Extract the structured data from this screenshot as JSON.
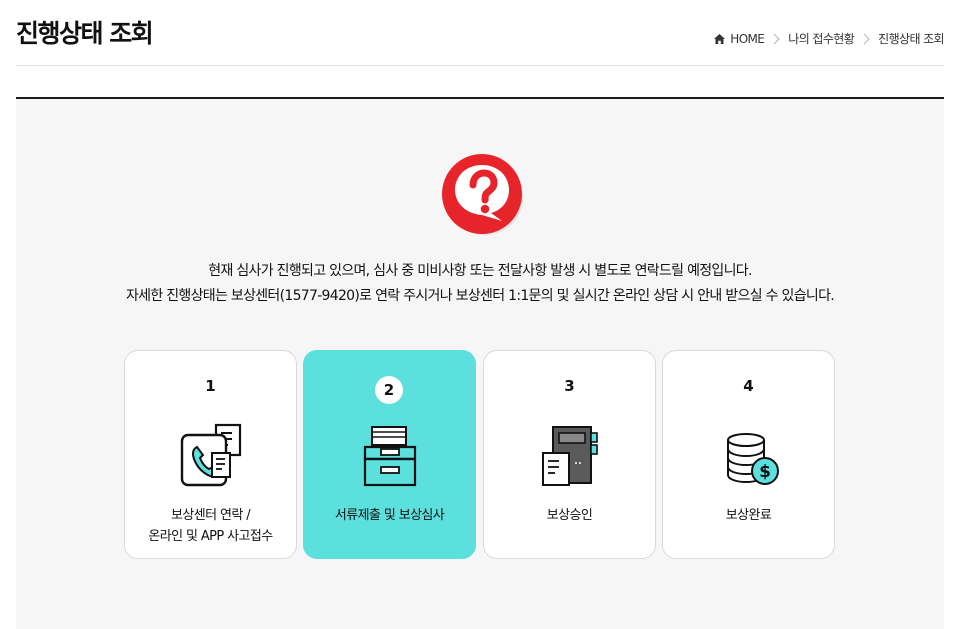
{
  "header": {
    "title": "진행상태 조회",
    "breadcrumb": [
      "HOME",
      "나의 접수현황",
      "진행상태 조회"
    ]
  },
  "icons": {
    "home": "home-icon",
    "chevron": "chevron-right-icon",
    "help": "question-bubble-icon"
  },
  "notice": {
    "line1": "현재 심사가 진행되고 있으며, 심사 중 미비사항 또는 전달사항 발생 시 별도로 연락드릴 예정입니다.",
    "line2": "자세한 진행상태는 보상센터(1577-9420)로 연락 주시거나 보상센터 1:1문의 및 실시간 온라인 상담 시 안내 받으실 수 있습니다."
  },
  "steps": [
    {
      "number": "1",
      "label_lines": [
        "보상센터 연락 /",
        "온라인 및 APP 사고접수"
      ],
      "icon": "phone-document-icon",
      "active": false
    },
    {
      "number": "2",
      "label_lines": [
        "서류제출 및 보상심사"
      ],
      "icon": "file-cabinet-icon",
      "active": true
    },
    {
      "number": "3",
      "label_lines": [
        "보상승인"
      ],
      "icon": "binder-document-icon",
      "active": false
    },
    {
      "number": "4",
      "label_lines": [
        "보상완료"
      ],
      "icon": "coin-stack-icon",
      "active": false
    }
  ],
  "colors": {
    "accent": "#5ce0dd",
    "help_red": "#e8242b",
    "panel_bg": "#f6f6f6"
  }
}
